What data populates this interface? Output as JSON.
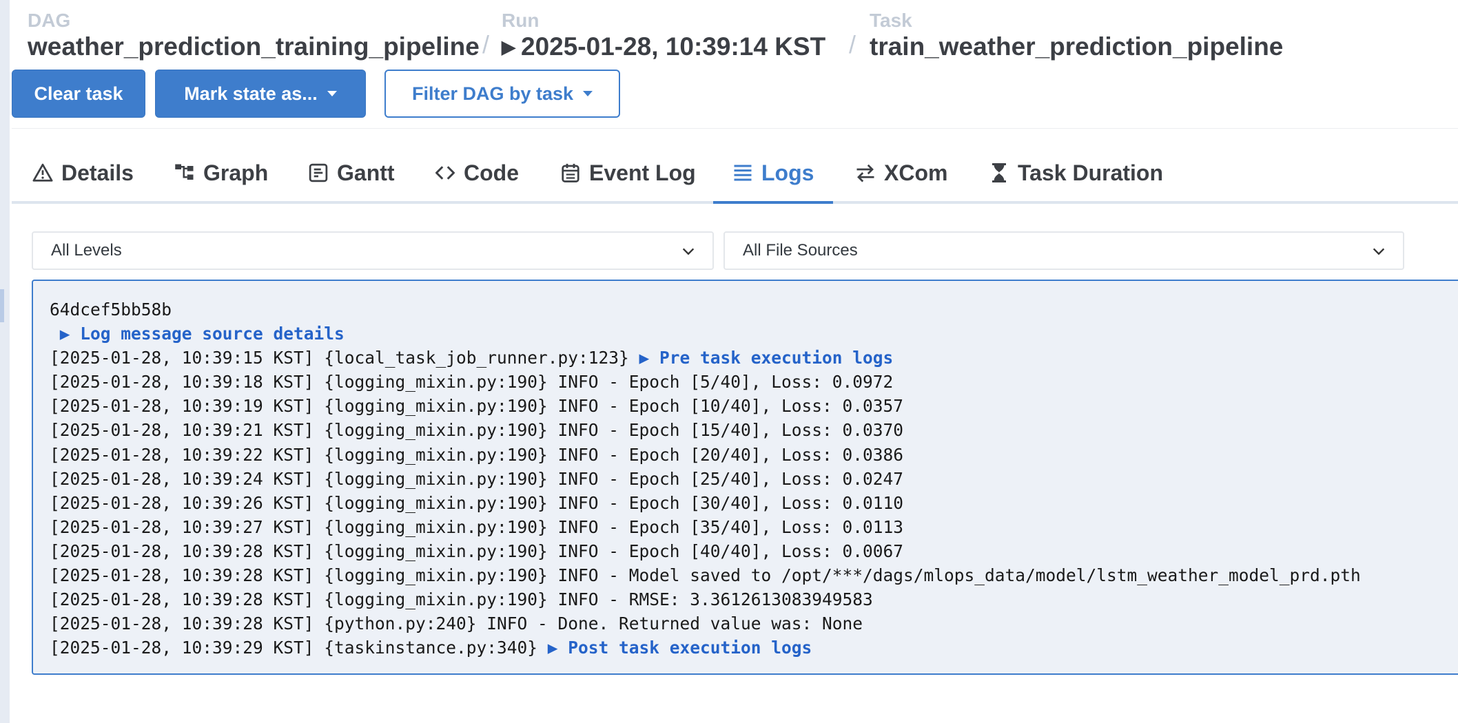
{
  "breadcrumb": {
    "dag": {
      "label": "DAG",
      "value": "weather_prediction_training_pipeline"
    },
    "run": {
      "label": "Run",
      "value": "2025-01-28, 10:39:14 KST"
    },
    "task": {
      "label": "Task",
      "value": "train_weather_prediction_pipeline"
    },
    "separator": "/",
    "play_glyph": "▶"
  },
  "actions": {
    "clear_task": "Clear task",
    "mark_state": "Mark state as...",
    "filter_dag": "Filter DAG by task"
  },
  "tabs": [
    {
      "label": "Details",
      "icon": "warning-triangle-icon"
    },
    {
      "label": "Graph",
      "icon": "graph-icon"
    },
    {
      "label": "Gantt",
      "icon": "gantt-icon"
    },
    {
      "label": "Code",
      "icon": "code-icon"
    },
    {
      "label": "Event Log",
      "icon": "calendar-icon"
    },
    {
      "label": "Logs",
      "icon": "list-icon",
      "active": true
    },
    {
      "label": "XCom",
      "icon": "swap-arrows-icon"
    },
    {
      "label": "Task Duration",
      "icon": "hourglass-icon"
    }
  ],
  "filters": {
    "level_select": "All Levels",
    "source_select": "All File Sources"
  },
  "log": {
    "lines": [
      {
        "text": "64dcef5bb58b",
        "link": ""
      },
      {
        "text": " ",
        "link": "▶ Log message source details"
      },
      {
        "text": "[2025-01-28, 10:39:15 KST] {local_task_job_runner.py:123} ",
        "link": "▶ Pre task execution logs"
      },
      {
        "text": "[2025-01-28, 10:39:18 KST] {logging_mixin.py:190} INFO - Epoch [5/40], Loss: 0.0972",
        "link": ""
      },
      {
        "text": "[2025-01-28, 10:39:19 KST] {logging_mixin.py:190} INFO - Epoch [10/40], Loss: 0.0357",
        "link": ""
      },
      {
        "text": "[2025-01-28, 10:39:21 KST] {logging_mixin.py:190} INFO - Epoch [15/40], Loss: 0.0370",
        "link": ""
      },
      {
        "text": "[2025-01-28, 10:39:22 KST] {logging_mixin.py:190} INFO - Epoch [20/40], Loss: 0.0386",
        "link": ""
      },
      {
        "text": "[2025-01-28, 10:39:24 KST] {logging_mixin.py:190} INFO - Epoch [25/40], Loss: 0.0247",
        "link": ""
      },
      {
        "text": "[2025-01-28, 10:39:26 KST] {logging_mixin.py:190} INFO - Epoch [30/40], Loss: 0.0110",
        "link": ""
      },
      {
        "text": "[2025-01-28, 10:39:27 KST] {logging_mixin.py:190} INFO - Epoch [35/40], Loss: 0.0113",
        "link": ""
      },
      {
        "text": "[2025-01-28, 10:39:28 KST] {logging_mixin.py:190} INFO - Epoch [40/40], Loss: 0.0067",
        "link": ""
      },
      {
        "text": "[2025-01-28, 10:39:28 KST] {logging_mixin.py:190} INFO - Model saved to /opt/***/dags/mlops_data/model/lstm_weather_model_prd.pth",
        "link": ""
      },
      {
        "text": "[2025-01-28, 10:39:28 KST] {logging_mixin.py:190} INFO - RMSE: 3.3612613083949583",
        "link": ""
      },
      {
        "text": "[2025-01-28, 10:39:28 KST] {python.py:240} INFO - Done. Returned value was: None",
        "link": ""
      },
      {
        "text": "[2025-01-28, 10:39:29 KST] {taskinstance.py:340} ",
        "link": "▶ Post task execution logs"
      }
    ]
  },
  "colors": {
    "accent": "#3e7dcc",
    "log_background": "#edf1f7",
    "muted_label": "#c3cbd6"
  }
}
